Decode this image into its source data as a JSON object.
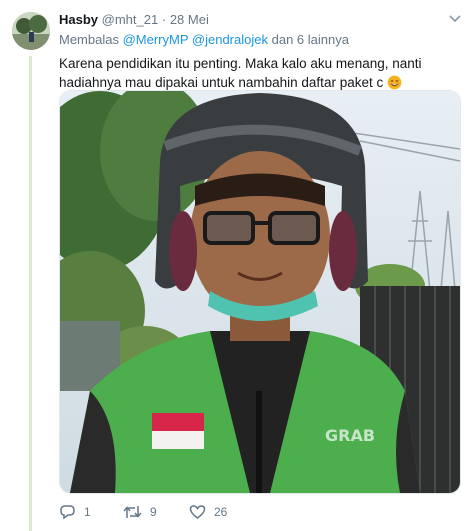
{
  "tweet": {
    "author_name": "Hasby",
    "handle": "@mht_21",
    "separator": "·",
    "date": "28 Mei",
    "reply_prefix": "Membalas",
    "mention_1": "@MerryMP",
    "mention_2": "@jendralojek",
    "reply_suffix": "dan 6 lainnya",
    "text": "Karena pendidikan itu penting. Maka kalo aku menang, nanti hadiahnya mau dipakai untuk nambahin daftar paket c",
    "emoji": "smiling-face-icon"
  },
  "actions": {
    "reply_count": "1",
    "retweet_count": "9",
    "like_count": "26"
  },
  "colors": {
    "link": "#1b95e0",
    "muted": "#657786",
    "thread_line": "#dde9d0",
    "jacket_green": "#4cae4c"
  }
}
